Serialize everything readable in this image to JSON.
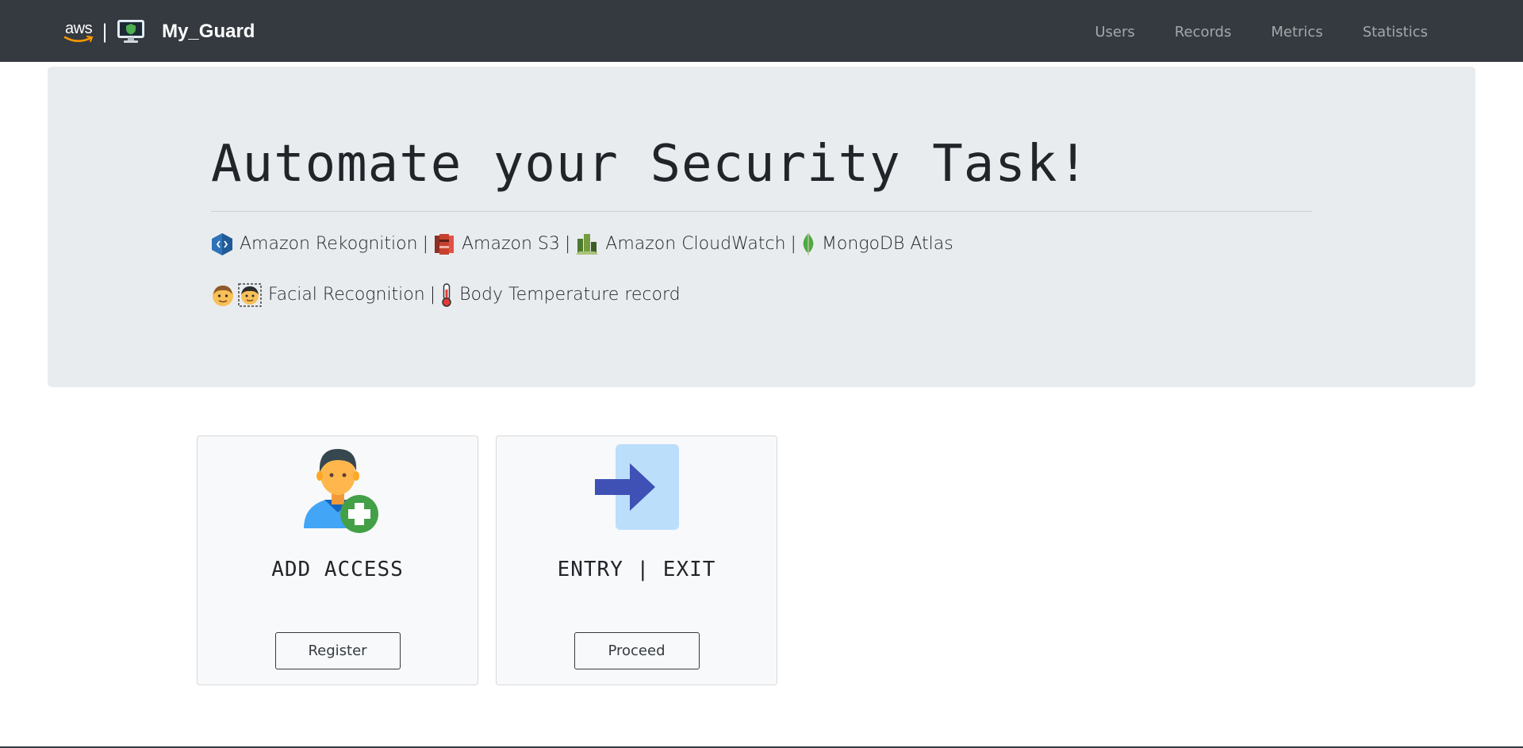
{
  "navbar": {
    "aws_logo_text": "aws",
    "brand_name": "My_Guard",
    "links": [
      "Users",
      "Records",
      "Metrics",
      "Statistics"
    ]
  },
  "hero": {
    "title": "Automate your Security Task!",
    "services": [
      {
        "icon": "rekognition-icon",
        "label": "Amazon Rekognition"
      },
      {
        "icon": "s3-icon",
        "label": "Amazon S3"
      },
      {
        "icon": "cloudwatch-icon",
        "label": "Amazon CloudWatch"
      },
      {
        "icon": "mongodb-leaf-icon",
        "label": "MongoDB Atlas"
      }
    ],
    "features": [
      {
        "label": "Facial Recognition"
      },
      {
        "label": "Body Temperature record"
      }
    ],
    "separator": "|"
  },
  "cards": [
    {
      "title": "ADD ACCESS",
      "button": "Register",
      "icon": "add-user-icon"
    },
    {
      "title": "ENTRY | EXIT",
      "button": "Proceed",
      "icon": "entry-arrow-icon"
    }
  ],
  "colors": {
    "navbar_bg": "#343a40",
    "jumbotron_bg": "#e9ecef",
    "card_bg": "#f8f9fa",
    "nav_link": "rgba(255,255,255,0.55)"
  }
}
